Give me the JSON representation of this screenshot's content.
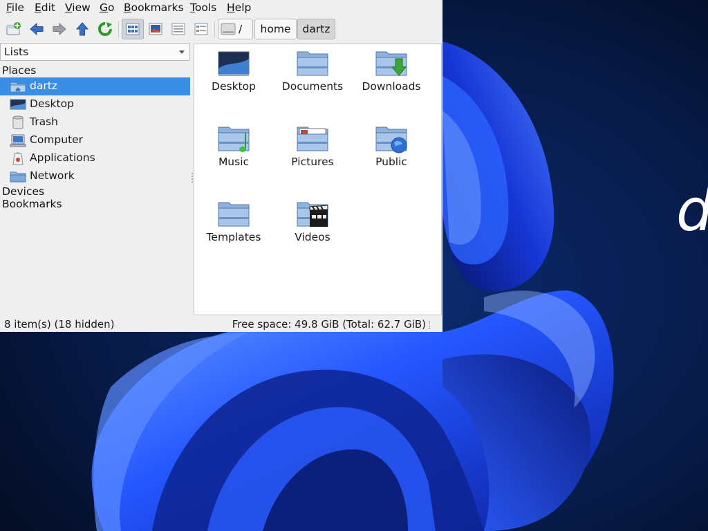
{
  "desktop": {
    "partial_text": "d"
  },
  "menubar": {
    "items": [
      "File",
      "Edit",
      "View",
      "Go",
      "Bookmarks",
      "Tools",
      "Help"
    ]
  },
  "toolbar": {
    "breadcrumbs": [
      "/",
      "home",
      "dartz"
    ]
  },
  "side_pane": {
    "mode_select": "Lists",
    "places_title": "Places",
    "places": [
      {
        "label": "dartz",
        "icon": "home-folder-icon",
        "selected": true
      },
      {
        "label": "Desktop",
        "icon": "desktop-icon",
        "selected": false
      },
      {
        "label": "Trash",
        "icon": "trash-icon",
        "selected": false
      },
      {
        "label": "Computer",
        "icon": "computer-icon",
        "selected": false
      },
      {
        "label": "Applications",
        "icon": "applications-icon",
        "selected": false
      },
      {
        "label": "Network",
        "icon": "network-icon",
        "selected": false
      }
    ],
    "devices_title": "Devices",
    "bookmarks_title": "Bookmarks"
  },
  "files": [
    {
      "label": "Desktop",
      "icon": "desktop-folder-icon"
    },
    {
      "label": "Documents",
      "icon": "documents-folder-icon"
    },
    {
      "label": "Downloads",
      "icon": "downloads-folder-icon"
    },
    {
      "label": "Music",
      "icon": "music-folder-icon"
    },
    {
      "label": "Pictures",
      "icon": "pictures-folder-icon"
    },
    {
      "label": "Public",
      "icon": "public-folder-icon"
    },
    {
      "label": "Templates",
      "icon": "templates-folder-icon"
    },
    {
      "label": "Videos",
      "icon": "videos-folder-icon"
    }
  ],
  "statusbar": {
    "items_text": "8 item(s) (18 hidden)",
    "free_space_text": "Free space: 49.8 GiB (Total: 62.7 GiB)"
  },
  "colors": {
    "selection": "#3a8ee6",
    "folder": "#7fa3cf",
    "wallpaper_dark": "#06112e",
    "wallpaper_blue": "#1f4dff"
  }
}
